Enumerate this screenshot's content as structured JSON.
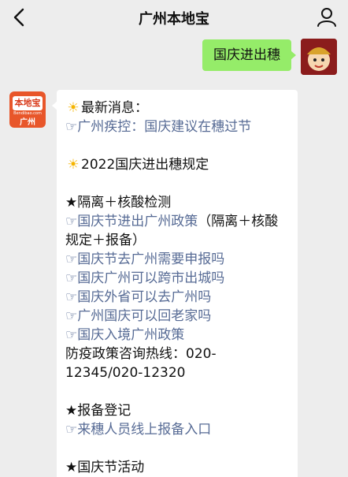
{
  "header": {
    "title": "广州本地宝"
  },
  "chat": {
    "sent_message": "国庆进出穗",
    "account_logo": {
      "top": "本地宝",
      "url": "Bendibao.com",
      "city": "广州"
    },
    "reply": {
      "news_heading": "最新消息：",
      "news_link": "广州疾控：国庆建议在穗过节",
      "rules_heading": "2022国庆进出穗规定",
      "section1_title": "★隔离＋核酸检测",
      "links1": [
        "国庆节进出广州政策",
        "国庆节去广州需要申报吗",
        "国庆广州可以跨市出城吗",
        "国庆外省可以去广州吗",
        "广州国庆可以回老家吗",
        "国庆入境广州政策"
      ],
      "link1_suffix": "（隔离＋核酸规定＋报备）",
      "hotline_line1": "防疫政策咨询热线：020-",
      "hotline_line2": "12345/020-12320",
      "section2_title": "★报备登记",
      "link2": "来穗人员线上报备入口",
      "section3_title": "★国庆节活动"
    }
  },
  "colors": {
    "link": "#576b95",
    "bubble_out": "#95ec69",
    "background": "#ededed"
  },
  "icons": {
    "back": "chevron-left-icon",
    "user": "user-icon",
    "sun": "sun-icon",
    "hand": "pointing-hand-icon"
  }
}
